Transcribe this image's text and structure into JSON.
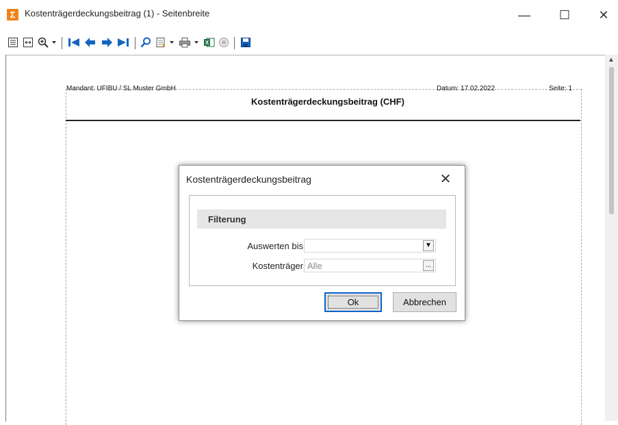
{
  "window": {
    "app_icon": "Σ",
    "title": "Kostenträgerdeckungsbeitrag (1) - Seitenbreite",
    "minimize": "—",
    "maximize": "☐",
    "close": "✕"
  },
  "toolbar": {
    "icons": [
      "single-page-icon",
      "page-width-icon",
      "zoom-icon",
      "first-page-icon",
      "previous-page-icon",
      "next-page-icon",
      "last-page-icon",
      "search-icon",
      "export-icon",
      "print-icon",
      "excel-icon",
      "record-icon",
      "save-icon"
    ],
    "colors": {
      "nav_blue": "#1565c0",
      "excel_green": "#1e7145"
    }
  },
  "report": {
    "mandant": "Mandant:  UFIBU  /  SL Muster GmbH",
    "datum": "Datum:  17.02.2022",
    "seite": "Seite:  1",
    "title": "Kostenträgerdeckungsbeitrag (CHF)"
  },
  "dialog": {
    "title": "Kostenträgerdeckungsbeitrag",
    "close": "✕",
    "section": "Filterung",
    "fields": [
      {
        "label": "Auswerten bis",
        "value": "",
        "button": "▼"
      },
      {
        "label": "Kostenträger",
        "value": "Alle",
        "button": "..."
      }
    ],
    "ok": "Ok",
    "cancel": "Abbrechen"
  }
}
